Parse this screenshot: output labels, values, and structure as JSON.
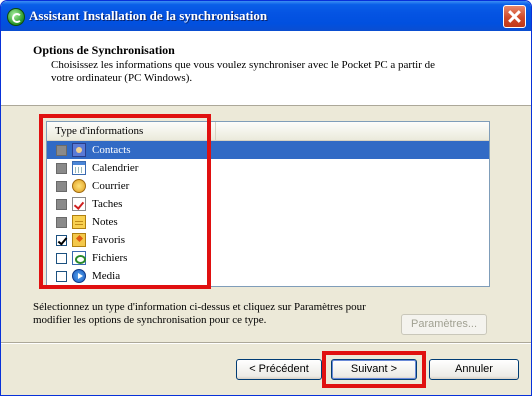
{
  "window": {
    "title": "Assistant Installation de la synchronisation"
  },
  "header": {
    "title": "Options de Synchronisation",
    "description": "Choisissez les informations que vous voulez synchroniser avec le Pocket PC a partir de votre ordinateur (PC Windows)."
  },
  "list": {
    "column_header": "Type d'informations",
    "items": [
      {
        "label": "Contacts",
        "icon": "contacts-icon",
        "state": "disabled",
        "selected": true
      },
      {
        "label": "Calendrier",
        "icon": "calendar-icon",
        "state": "disabled",
        "selected": false
      },
      {
        "label": "Courrier",
        "icon": "mail-icon",
        "state": "disabled",
        "selected": false
      },
      {
        "label": "Taches",
        "icon": "tasks-icon",
        "state": "disabled",
        "selected": false
      },
      {
        "label": "Notes",
        "icon": "notes-icon",
        "state": "disabled",
        "selected": false
      },
      {
        "label": "Favoris",
        "icon": "favorites-icon",
        "state": "checked",
        "selected": false
      },
      {
        "label": "Fichiers",
        "icon": "files-icon",
        "state": "unchecked",
        "selected": false
      },
      {
        "label": "Media",
        "icon": "media-icon",
        "state": "unchecked",
        "selected": false
      }
    ]
  },
  "hint": "Sélectionnez un type d'information ci-dessus et cliquez sur Paramètres pour modifier les options de synchronisation pour ce type.",
  "buttons": {
    "parametres": "Paramètres...",
    "precedent": "< Précédent",
    "suivant": "Suivant >",
    "annuler": "Annuler"
  },
  "colors": {
    "titlebar": "#0554e3",
    "selection": "#316ac5",
    "highlight_box": "#e01010",
    "dialog_bg": "#ece9d8"
  }
}
